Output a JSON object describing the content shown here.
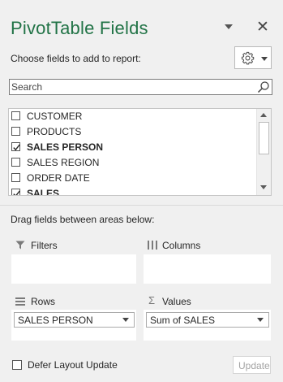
{
  "header": {
    "title": "PivotTable Fields",
    "close_glyph": "✕",
    "icons": [
      "dropdown-arrow-icon",
      "close-icon"
    ]
  },
  "fields_section": {
    "choose_label": "Choose fields to add to report:",
    "settings_icon": "gear-icon",
    "search": {
      "placeholder": "Search",
      "value": "",
      "icon": "search-icon"
    },
    "fields": [
      {
        "label": "CUSTOMER",
        "checked": false,
        "bold": false
      },
      {
        "label": "PRODUCTS",
        "checked": false,
        "bold": false
      },
      {
        "label": "SALES PERSON",
        "checked": true,
        "bold": true
      },
      {
        "label": "SALES REGION",
        "checked": false,
        "bold": false
      },
      {
        "label": "ORDER DATE",
        "checked": false,
        "bold": false
      },
      {
        "label": "SALES",
        "checked": true,
        "bold": true
      }
    ]
  },
  "areas": {
    "drag_label": "Drag fields between areas below:",
    "filters": {
      "label": "Filters",
      "icon": "filter-icon"
    },
    "columns": {
      "label": "Columns",
      "icon": "columns-icon"
    },
    "rows": {
      "label": "Rows",
      "icon": "rows-icon",
      "item": "SALES PERSON"
    },
    "values": {
      "label": "Values",
      "icon": "sigma-icon",
      "glyph": "Σ",
      "item": "Sum of SALES"
    }
  },
  "footer": {
    "defer_label": "Defer Layout Update",
    "defer_checked": false,
    "update_label": "Update"
  },
  "colors": {
    "title": "#217346",
    "background": "#f0f0f0"
  }
}
